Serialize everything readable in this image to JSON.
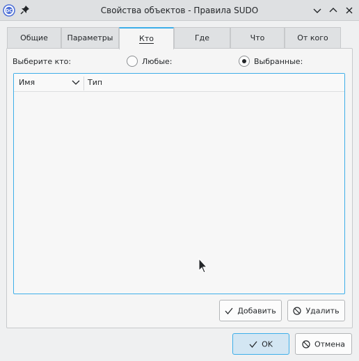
{
  "window": {
    "title": "Свойства объектов - Правила SUDO",
    "app_icon": "admc-icon",
    "buttons": [
      "pin-icon",
      "minimize-icon",
      "maximize-icon",
      "close-icon"
    ]
  },
  "tabs": [
    {
      "label": "Общие",
      "active": false
    },
    {
      "label": "Параметры",
      "active": false
    },
    {
      "label": "Кто",
      "active": true
    },
    {
      "label": "Где",
      "active": false
    },
    {
      "label": "Что",
      "active": false
    },
    {
      "label": "От кого",
      "active": false
    }
  ],
  "who": {
    "select_label": "Выберите кто:",
    "option_any": {
      "label": "Любые:",
      "checked": false
    },
    "option_selected": {
      "label": "Выбранные:",
      "checked": true
    }
  },
  "list": {
    "columns": [
      {
        "label": "Имя",
        "sorted": true
      },
      {
        "label": "Тип",
        "sorted": false
      }
    ],
    "rows": []
  },
  "actions": {
    "add_label": "Добавить",
    "remove_label": "Удалить"
  },
  "dialog": {
    "ok_label": "OK",
    "cancel_label": "Отмена"
  },
  "colors": {
    "accent": "#3daee9",
    "window_bg": "#eff0f1",
    "text": "#232629"
  }
}
